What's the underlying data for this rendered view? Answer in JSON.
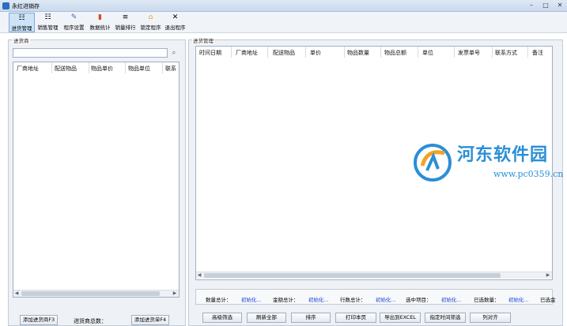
{
  "window": {
    "title": "永红进销存",
    "minimize": "–",
    "maximize": "□",
    "close": "✕"
  },
  "toolbar": [
    {
      "label": "进货管理",
      "icon": "purchase-icon",
      "glyph": "☷"
    },
    {
      "label": "销售管理",
      "icon": "sales-icon",
      "glyph": "☷"
    },
    {
      "label": "程序设置",
      "icon": "settings-icon",
      "glyph": "✎"
    },
    {
      "label": "数据统计",
      "icon": "stats-icon",
      "glyph": "▮"
    },
    {
      "label": "销量排行",
      "icon": "ranking-icon",
      "glyph": "≡"
    },
    {
      "label": "锁定程序",
      "icon": "lock-icon",
      "glyph": "⌂"
    },
    {
      "label": "退出程序",
      "icon": "exit-icon",
      "glyph": "✕"
    }
  ],
  "left": {
    "title": "进货商",
    "search_placeholder": "",
    "columns": [
      "厂商地址",
      "配送物品",
      "物品单价",
      "物品单位",
      "联系"
    ],
    "add_supplier": "添加进货商F3",
    "count_label": "进货商总数：",
    "add_order": "添加进货单F4"
  },
  "right": {
    "title": "进货管理",
    "columns": [
      "时间日期",
      "厂商地址",
      "配送物品",
      "单价",
      "物品数量",
      "物品总额",
      "单位",
      "发票单号",
      "联系方式",
      "备注"
    ],
    "stats": [
      {
        "label": "数量总计：",
        "value": "初始化..."
      },
      {
        "label": "金额总计：",
        "value": "初始化..."
      },
      {
        "label": "行数总计：",
        "value": "初始化..."
      },
      {
        "label": "选中项目：",
        "value": "初始化..."
      },
      {
        "label": "已选数量：",
        "value": "初始化..."
      },
      {
        "label": "已选金",
        "value": ""
      }
    ],
    "buttons": [
      "高级筛选",
      "刷新全部",
      "排序",
      "打印本页",
      "导出到EXCEL",
      "指定时间筛选",
      "列对齐"
    ]
  },
  "watermark": {
    "text": "河东软件园",
    "url": "www.pc0359.cn"
  },
  "colors": {
    "accent": "#1a3fd8",
    "watermark": "#2a8fd6"
  }
}
